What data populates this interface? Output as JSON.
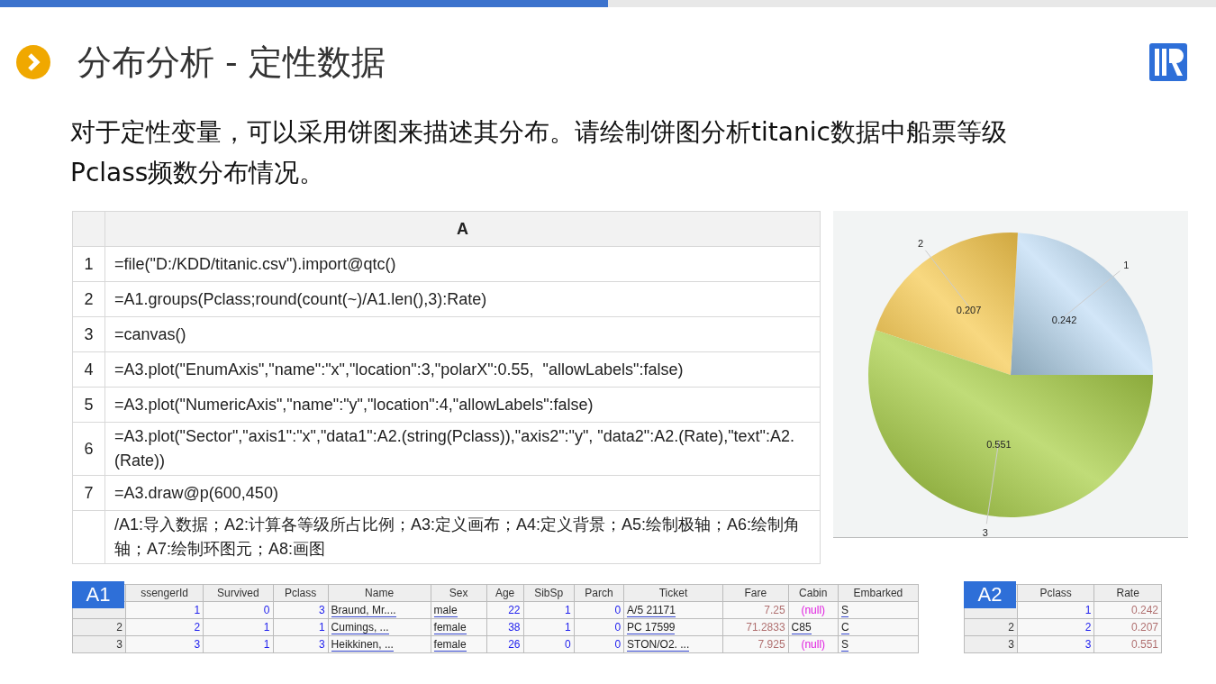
{
  "progress": {
    "level": 0.5
  },
  "title": "分布分析 - 定性数据",
  "intro": "对于定性变量，可以采用饼图来描述其分布。请绘制饼图分析titanic数据中船票等级Pclass频数分布情况。",
  "code_grid": {
    "column": "A",
    "rows": [
      {
        "num": "1",
        "code": "=file(\"D:/KDD/titanic.csv\").import@qtc()"
      },
      {
        "num": "2",
        "code": "=A1.groups(Pclass;round(count(~)/A1.len(),3):Rate)"
      },
      {
        "num": "3",
        "code": "=canvas()"
      },
      {
        "num": "4",
        "code": "=A3.plot(\"EnumAxis\",\"name\":\"x\",\"location\":3,\"polarX\":0.55,  \"allowLabels\":false)"
      },
      {
        "num": "5",
        "code": "=A3.plot(\"NumericAxis\",\"name\":\"y\",\"location\":4,\"allowLabels\":false)"
      },
      {
        "num": "6",
        "code": "=A3.plot(\"Sector\",\"axis1\":\"x\",\"data1\":A2.(string(Pclass)),\"axis2\":\"y\", \"data2\":A2.(Rate),\"text\":A2.(Rate))"
      },
      {
        "num": "7",
        "code": "=A3.draw@p(600,450)"
      },
      {
        "code": "/A1:导入数据；A2:计算各等级所占比例；A3:定义画布；A4:定义背景；A5:绘制极轴；A6:绘制角轴；A7:绘制环图元；A8:画图"
      }
    ]
  },
  "pie": {
    "chart_data": {
      "type": "pie",
      "categories": [
        "1",
        "2",
        "3"
      ],
      "values": [
        0.242,
        0.207,
        0.551
      ],
      "data_labels": true
    }
  },
  "tables": [
    {
      "label": "A1",
      "columns": [
        "",
        "ssengerId",
        "Survived",
        "Pclass",
        "Name",
        "Sex",
        "Age",
        "SibSp",
        "Parch",
        "Ticket",
        "Fare",
        "Cabin",
        "Embarked"
      ],
      "rows": [
        [
          {
            "kind": "idx"
          },
          {
            "text": "1",
            "kind": "num"
          },
          {
            "text": "0",
            "kind": "num"
          },
          {
            "text": "3",
            "kind": "num"
          },
          {
            "text": "Braund, Mr....",
            "kind": "str"
          },
          {
            "text": "male",
            "kind": "str"
          },
          {
            "text": "22",
            "kind": "num"
          },
          {
            "text": "1",
            "kind": "num"
          },
          {
            "text": "0",
            "kind": "num"
          },
          {
            "text": "A/5 21171",
            "kind": "str"
          },
          {
            "text": "7.25",
            "kind": "float"
          },
          {
            "text": "(null)",
            "kind": "null"
          },
          {
            "text": "S",
            "kind": "str"
          }
        ],
        [
          {
            "text": "2",
            "kind": "idx"
          },
          {
            "text": "2",
            "kind": "num"
          },
          {
            "text": "1",
            "kind": "num"
          },
          {
            "text": "1",
            "kind": "num"
          },
          {
            "text": "Cumings, ...",
            "kind": "str"
          },
          {
            "text": "female",
            "kind": "str"
          },
          {
            "text": "38",
            "kind": "num"
          },
          {
            "text": "1",
            "kind": "num"
          },
          {
            "text": "0",
            "kind": "num"
          },
          {
            "text": "PC 17599",
            "kind": "str"
          },
          {
            "text": "71.2833",
            "kind": "float"
          },
          {
            "text": "C85",
            "kind": "str"
          },
          {
            "text": "C",
            "kind": "str"
          }
        ],
        [
          {
            "text": "3",
            "kind": "idx"
          },
          {
            "text": "3",
            "kind": "num"
          },
          {
            "text": "1",
            "kind": "num"
          },
          {
            "text": "3",
            "kind": "num"
          },
          {
            "text": "Heikkinen, ...",
            "kind": "str"
          },
          {
            "text": "female",
            "kind": "str"
          },
          {
            "text": "26",
            "kind": "num"
          },
          {
            "text": "0",
            "kind": "num"
          },
          {
            "text": "0",
            "kind": "num"
          },
          {
            "text": "STON/O2. ...",
            "kind": "str"
          },
          {
            "text": "7.925",
            "kind": "float"
          },
          {
            "text": "(null)",
            "kind": "null"
          },
          {
            "text": "S",
            "kind": "str"
          }
        ]
      ]
    },
    {
      "label": "A2",
      "columns": [
        "",
        "Pclass",
        "Rate"
      ],
      "rows": [
        [
          {
            "kind": "idx"
          },
          {
            "text": "1",
            "kind": "num"
          },
          {
            "text": "0.242",
            "kind": "float"
          }
        ],
        [
          {
            "text": "2",
            "kind": "idx"
          },
          {
            "text": "2",
            "kind": "num"
          },
          {
            "text": "0.207",
            "kind": "float"
          }
        ],
        [
          {
            "text": "3",
            "kind": "idx"
          },
          {
            "text": "3",
            "kind": "num"
          },
          {
            "text": "0.551",
            "kind": "float"
          }
        ]
      ]
    }
  ]
}
